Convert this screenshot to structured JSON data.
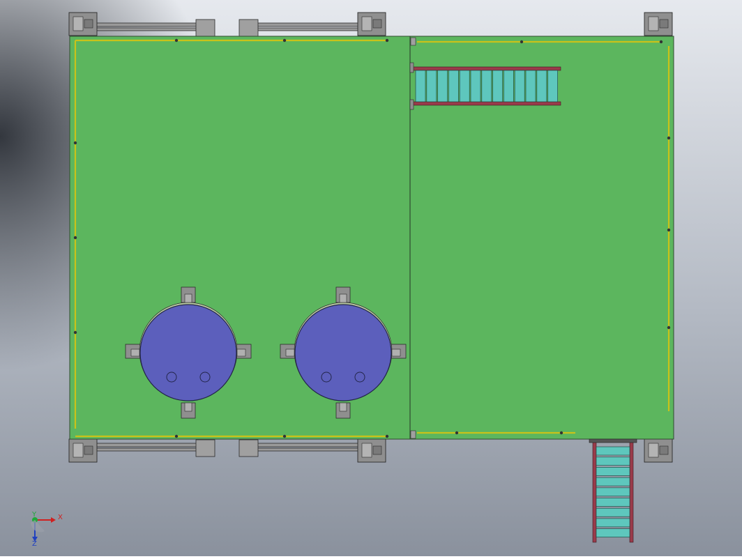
{
  "view": {
    "background_top": "#e6e9ee",
    "background_bottom": "#8a919d",
    "background_dark": "#2b2f36"
  },
  "colors": {
    "platform": "#5cb65e",
    "platform_edge": "#2f4a2f",
    "rail": "#c9c21a",
    "tank": "#5c5fbc",
    "tank_edge": "#23264a",
    "bracket": "#8f8f8f",
    "bracket_edge": "#2a2a2a",
    "stair_tread": "#5ec7bd",
    "stair_stringer": "#9a3b4a",
    "beam": "#9a9a9a"
  },
  "triad": {
    "x_label": "X",
    "y_label": "Y",
    "z_label": "Z"
  }
}
